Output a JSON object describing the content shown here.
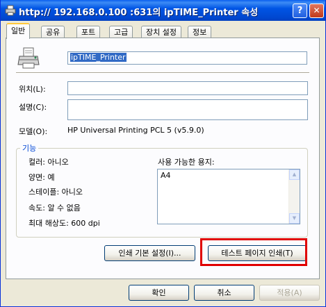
{
  "window": {
    "title": "http:// 192.168.0.100 :631의 ipTIME_Printer 속성",
    "help_glyph": "?",
    "close_glyph": "✕"
  },
  "tabs": [
    {
      "label": "일반",
      "active": true
    },
    {
      "label": "공유"
    },
    {
      "label": "포트"
    },
    {
      "label": "고급"
    },
    {
      "label": "장치 설정"
    },
    {
      "label": "정보"
    }
  ],
  "general": {
    "printer_name": "ipTIME_Printer",
    "location_label": "위치(L):",
    "location_value": "",
    "comment_label": "설명(C):",
    "comment_value": "",
    "model_label": "모델(O):",
    "model_value": "HP Universal Printing PCL 5 (v5.9.0)"
  },
  "features": {
    "group_title": "기능",
    "color": "컬러: 아니오",
    "duplex": "양면: 예",
    "staple": "스테이플: 아니오",
    "speed": "속도: 알 수 없음",
    "max_resolution": "최대 해상도: 600 dpi",
    "paper_label": "사용 가능한 용지:",
    "papers": [
      "A4"
    ]
  },
  "buttons": {
    "preferences": "인쇄 기본 설정(I)...",
    "test_page": "테스트 페이지 인쇄(T)",
    "ok": "확인",
    "cancel": "취소",
    "apply": "적용(A)"
  },
  "colors": {
    "titlebar": "#0055E5",
    "highlight": "#E00000",
    "tab_accent": "#FFC83C"
  }
}
